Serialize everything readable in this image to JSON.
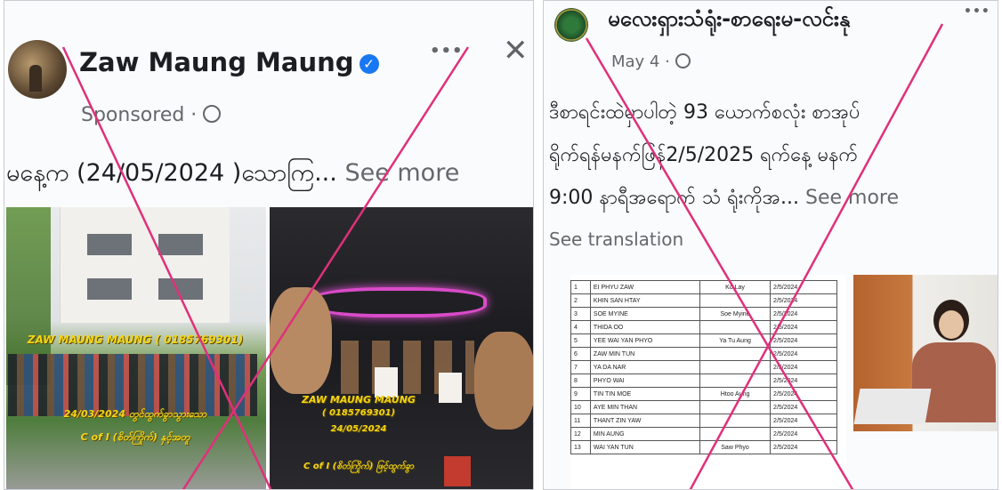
{
  "left_post": {
    "author": "Zaw Maung Maung",
    "meta": "Sponsored · ",
    "more": "•••",
    "close": "✕",
    "text": "မနေ့က (24/05/2024 )သောကြ...",
    "see_more": "See more",
    "photo1_caption": [
      "ZAW MAUNG MAUNG ( 0185769301)",
      "24/03/2024 တွင်ထွက်ခွာသွားသော"
    ],
    "photo1_bottom": "C of I (စိတ်ကြိုက်) နှင့်အတူ",
    "photo2_caption": [
      "ZAW MAUNG MAUNG",
      "( 0185769301)",
      "24/05/2024"
    ],
    "photo2_bottom": "C of I (စိတ်ကြိုက်) ဖြင့်ထွက်ခွာ"
  },
  "right_post": {
    "author": "မလေးရှားသံရုံး-စာရေးမ-လင်းနု",
    "meta": "May 4 · ",
    "more": "•••",
    "text_lines": [
      "ဒီစာရင်းထဲမှာပါတဲ့ 93 ယောက်စလုံး စာအုပ်",
      "ရိုက်ရန်မနက်ဖြန်2/5/2025 ရက်နေ့ မနက်",
      "9:00 နာရီအရောက် သံ ရုံးကိုအ..."
    ],
    "see_more": "See more",
    "see_translation": "See translation",
    "table": [
      [
        "1",
        "EI PHYU ZAW",
        "Ko Lay",
        "2/5/2024"
      ],
      [
        "2",
        "KHIN SAN HTAY",
        "",
        "2/5/2024"
      ],
      [
        "3",
        "SOE MYINE",
        "Soe Myine",
        "2/5/2024"
      ],
      [
        "4",
        "THIDA OO",
        "",
        "2/5/2024"
      ],
      [
        "5",
        "YEE WAI YAN PHYO",
        "Ya Tu Aung",
        "2/5/2024"
      ],
      [
        "6",
        "ZAW MIN TUN",
        "",
        "2/5/2024"
      ],
      [
        "7",
        "YA DA NAR",
        "",
        "2/5/2024"
      ],
      [
        "8",
        "PHYO WAI",
        "",
        "2/5/2024"
      ],
      [
        "9",
        "TIN TIN MOE",
        "Htoo Aung",
        "2/5/2024"
      ],
      [
        "10",
        "AYE MIN THAN",
        "",
        "2/5/2024"
      ],
      [
        "11",
        "THANT ZIN YAW",
        "",
        "2/5/2024"
      ],
      [
        "12",
        "MIN AUNG",
        "",
        "2/5/2024"
      ],
      [
        "13",
        "WAI YAN TUN",
        "Saw Phyo",
        "2/5/2024"
      ]
    ]
  },
  "colors": {
    "x_mark": "#e0307a",
    "caption_yellow": "#f5d416",
    "verified_blue": "#1877f2"
  }
}
